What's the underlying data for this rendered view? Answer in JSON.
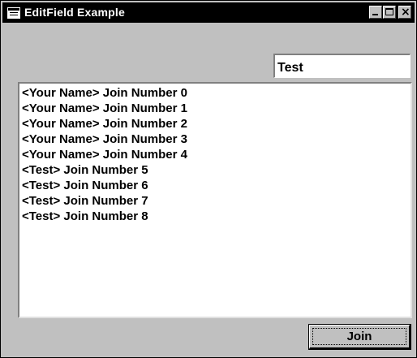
{
  "window": {
    "title": "EditField Example",
    "close_glyph": "×"
  },
  "edit_field": {
    "value": "Test"
  },
  "list": {
    "items": [
      "<Your Name> Join Number 0",
      "<Your Name> Join Number 1",
      "<Your Name> Join Number 2",
      "<Your Name> Join Number 3",
      "<Your Name> Join Number 4",
      "<Test> Join Number 5",
      "<Test> Join Number 6",
      "<Test> Join Number 7",
      "<Test> Join Number 8"
    ]
  },
  "buttons": {
    "join_label": "Join"
  },
  "colors": {
    "title_bar": "#000000",
    "face": "#c0c0c0",
    "field_bg": "#ffffff"
  }
}
